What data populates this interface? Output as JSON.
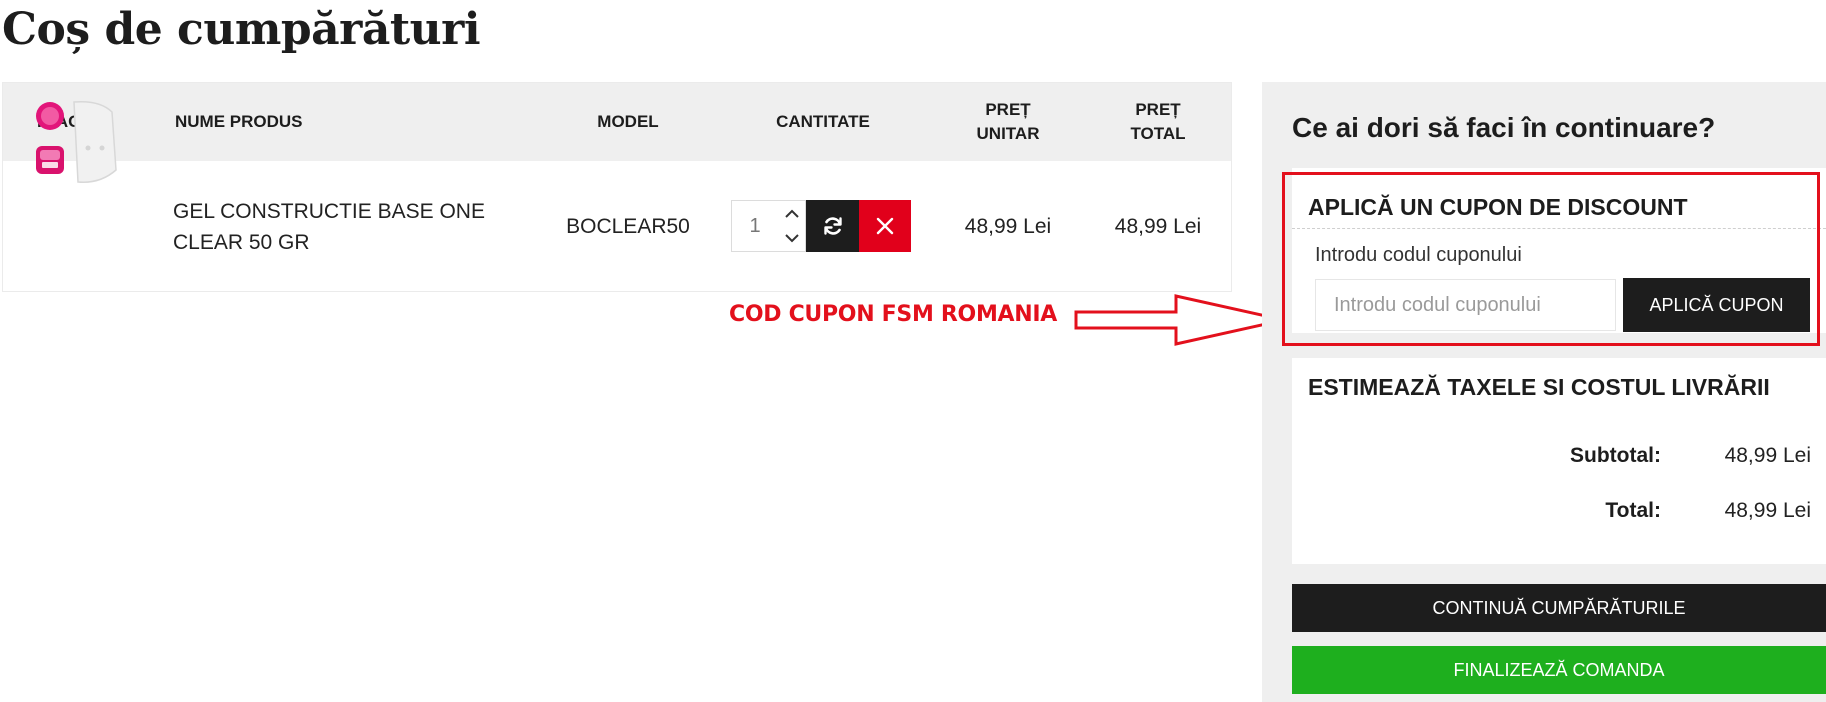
{
  "page": {
    "title": "Coș de cumpărături"
  },
  "table": {
    "headers": {
      "image": "IMAGINE",
      "name": "NUME PRODUS",
      "model": "MODEL",
      "quantity": "CANTITATE",
      "unit_price_1": "PREȚ",
      "unit_price_2": "UNITAR",
      "total_price_1": "PREȚ",
      "total_price_2": "TOTAL"
    },
    "rows": [
      {
        "name_line_1": "GEL CONSTRUCTIE BASE ONE",
        "name_line_2": "CLEAR 50 GR",
        "model": "BOCLEAR50",
        "quantity": "1",
        "unit_price": "48,99 Lei",
        "total_price": "48,99 Lei"
      }
    ]
  },
  "annotation": {
    "label": "COD CUPON FSM ROMANIA"
  },
  "sidebar": {
    "title": "Ce ai dori să faci în continuare?",
    "coupon": {
      "title": "APLICĂ UN CUPON DE DISCOUNT",
      "field_label": "Introdu codul cuponului",
      "placeholder": "Introdu codul cuponului",
      "button": "APLICĂ CUPON"
    },
    "shipping": {
      "title": "ESTIMEAZĂ TAXELE SI COSTUL LIVRĂRII"
    },
    "totals": {
      "subtotal_label": "Subtotal:",
      "subtotal_value": "48,99 Lei",
      "total_label": "Total:",
      "total_value": "48,99 Lei"
    },
    "continue_button": "CONTINUĂ CUMPĂRĂTURILE",
    "checkout_button": "FINALIZEAZĂ COMANDA"
  },
  "colors": {
    "accent_red": "#e3101c",
    "dark": "#1d1d1d",
    "checkout_green": "#1eaf1e",
    "remove_red": "#e1001b",
    "panel_gray": "#efefef"
  },
  "icons": [
    "product-thumbnail",
    "chevron-up-icon",
    "chevron-down-icon",
    "refresh-icon",
    "close-icon",
    "arrow-right-icon"
  ]
}
